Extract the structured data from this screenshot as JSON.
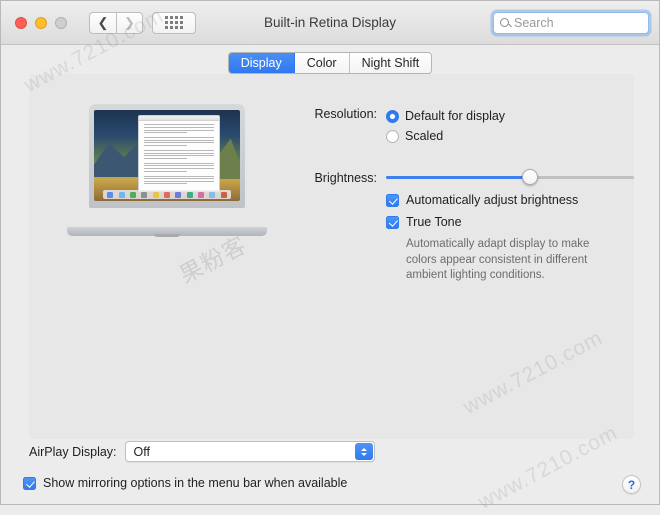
{
  "window": {
    "title": "Built-in Retina Display",
    "traffic_lights": [
      "close",
      "minimize",
      "zoom-disabled"
    ],
    "nav": {
      "back_icon": "chevron-left-icon",
      "forward_icon": "chevron-right-icon",
      "showall_icon": "grid-icon"
    }
  },
  "search": {
    "placeholder": "Search",
    "value": "",
    "icon": "search-icon"
  },
  "tabs": [
    {
      "label": "Display",
      "selected": true
    },
    {
      "label": "Color",
      "selected": false
    },
    {
      "label": "Night Shift",
      "selected": false
    }
  ],
  "preview": {
    "device": "macbook-pro-preview",
    "wallpaper": "high-sierra"
  },
  "resolution": {
    "label": "Resolution:",
    "options": [
      {
        "label": "Default for display",
        "selected": true
      },
      {
        "label": "Scaled",
        "selected": false
      }
    ]
  },
  "brightness": {
    "label": "Brightness:",
    "value_percent": 58,
    "min": 0,
    "max": 100
  },
  "checkboxes": [
    {
      "label": "Automatically adjust brightness",
      "checked": true
    },
    {
      "label": "True Tone",
      "checked": true
    }
  ],
  "true_tone_description": "Automatically adapt display to make colors appear consistent in different ambient lighting conditions.",
  "airplay": {
    "label": "AirPlay Display:",
    "value": "Off",
    "options": [
      "Off"
    ],
    "icon": "chevron-updown-icon"
  },
  "mirroring": {
    "label": "Show mirroring options in the menu bar when available",
    "checked": true
  },
  "help": {
    "label": "?",
    "icon": "help-icon"
  },
  "watermarks": [
    "www.7210.com",
    "www.7210.com",
    "果粉客",
    "www.7210.com"
  ],
  "colors": {
    "accent": "#2f7ced",
    "tab_selected": "#3d7fef",
    "window_bg": "#ececec",
    "panel_bg": "#e7e7e7",
    "traffic_close": "#ff5f57",
    "traffic_min": "#febc2e",
    "traffic_zoom": "#cfcfcf",
    "help_glyph": "#2b6fd4",
    "description_text": "#6d6d6d"
  }
}
